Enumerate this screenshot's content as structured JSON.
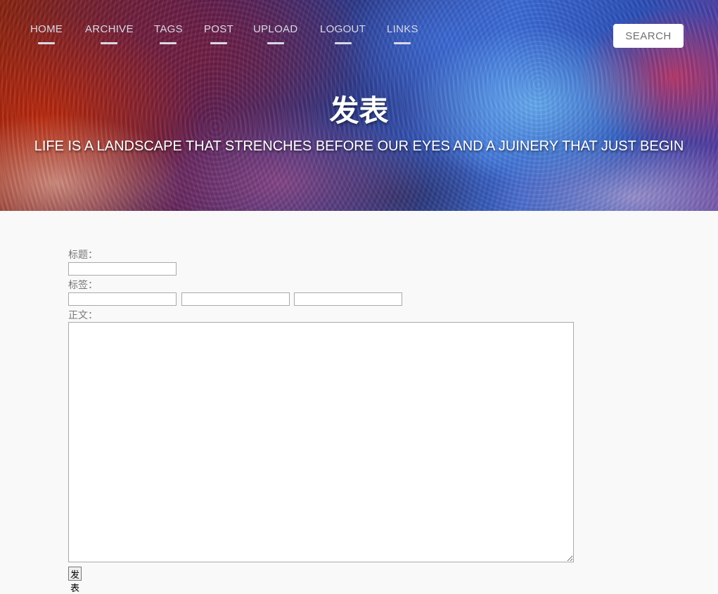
{
  "nav": {
    "items": [
      {
        "label": "HOME"
      },
      {
        "label": "ARCHIVE"
      },
      {
        "label": "TAGS"
      },
      {
        "label": "POST"
      },
      {
        "label": "UPLOAD"
      },
      {
        "label": "LOGOUT"
      },
      {
        "label": "LINKS"
      }
    ],
    "search_label": "SEARCH"
  },
  "header": {
    "title": "发表",
    "subtitle": "LIFE IS A LANDSCAPE THAT STRENCHES BEFORE OUR EYES AND A JUINERY THAT JUST BEGIN"
  },
  "form": {
    "title_label": "标题：",
    "title_value": "",
    "tags_label": "标签：",
    "tag_values": [
      "",
      "",
      ""
    ],
    "body_label": "正文：",
    "body_value": "",
    "submit_label": "发表"
  },
  "colors": {
    "page_background": "#f8f9f8",
    "nav_text": "#d9d9e6",
    "label_text": "#777777"
  }
}
